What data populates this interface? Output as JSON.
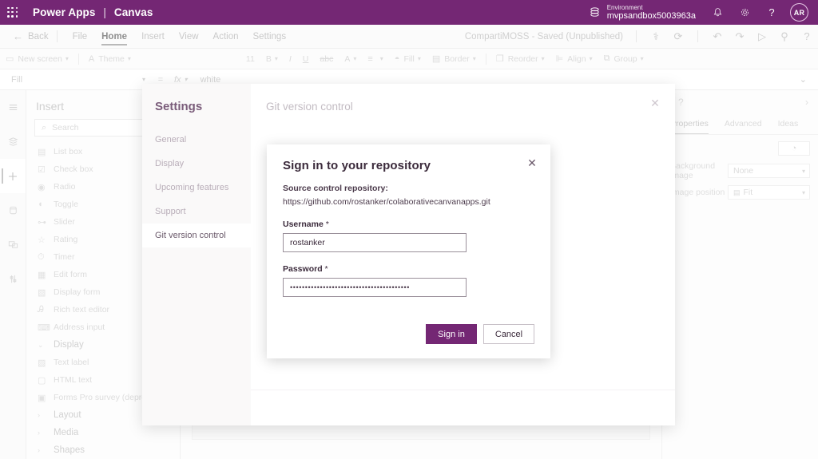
{
  "brandbar": {
    "waffle_icon": "app-launcher-icon",
    "app_name": "Power Apps",
    "separator": "|",
    "app_mode": "Canvas",
    "environment_icon": "environment-icon",
    "environment_label": "Environment",
    "environment_name": "mvpsandbox5003963a",
    "notifications_icon": "bell-icon",
    "settings_icon": "gear-icon",
    "help_icon": "question-icon",
    "avatar_initials": "AR",
    "accent_color": "#742774"
  },
  "menubar": {
    "back_label": "Back",
    "items": [
      {
        "label": "File",
        "active": false
      },
      {
        "label": "Home",
        "active": true
      },
      {
        "label": "Insert",
        "active": false
      },
      {
        "label": "View",
        "active": false
      },
      {
        "label": "Action",
        "active": false
      },
      {
        "label": "Settings",
        "active": false
      }
    ],
    "saved_status": "CompartiMOSS - Saved (Unpublished)",
    "right_icons": [
      "checker-icon",
      "refresh-icon",
      "undo-icon",
      "redo-icon",
      "play-icon",
      "share-icon",
      "help-icon"
    ]
  },
  "ribbon": {
    "new_screen": "New screen",
    "theme": "Theme",
    "font_size": "11",
    "bold": "B",
    "italic": "I",
    "underline": "U",
    "strikethrough": "abc",
    "font_color": "A",
    "align": "align-icon",
    "fill": "Fill",
    "border": "Border",
    "reorder": "Reorder",
    "align_label": "Align",
    "group": "Group"
  },
  "formulabar": {
    "property": "Fill",
    "equals": "=",
    "fx": "fx",
    "value": "white",
    "expand_icon": "chevron-down-icon"
  },
  "rail": {
    "items": [
      {
        "name": "hamburger-icon",
        "active": false
      },
      {
        "name": "tree-view-icon",
        "active": false
      },
      {
        "name": "insert-icon",
        "active": true
      },
      {
        "name": "data-icon",
        "active": false
      },
      {
        "name": "media-icon",
        "active": false
      },
      {
        "name": "variables-icon",
        "active": false
      }
    ]
  },
  "insert_panel": {
    "title": "Insert",
    "search_placeholder": "Search",
    "search_icon": "search-icon",
    "items": [
      {
        "label": "List box",
        "icon": "listbox-icon",
        "type": "item"
      },
      {
        "label": "Check box",
        "icon": "checkbox-icon",
        "type": "item"
      },
      {
        "label": "Radio",
        "icon": "radio-icon",
        "type": "item"
      },
      {
        "label": "Toggle",
        "icon": "toggle-icon",
        "type": "item"
      },
      {
        "label": "Slider",
        "icon": "slider-icon",
        "type": "item"
      },
      {
        "label": "Rating",
        "icon": "star-icon",
        "type": "item"
      },
      {
        "label": "Timer",
        "icon": "timer-icon",
        "type": "item"
      },
      {
        "label": "Edit form",
        "icon": "edit-form-icon",
        "type": "item"
      },
      {
        "label": "Display form",
        "icon": "display-form-icon",
        "type": "item"
      },
      {
        "label": "Rich text editor",
        "icon": "rich-text-icon",
        "type": "item"
      },
      {
        "label": "Address input",
        "icon": "address-input-icon",
        "type": "item"
      },
      {
        "label": "Display",
        "icon": "chevron-down-icon",
        "type": "group"
      },
      {
        "label": "Text label",
        "icon": "text-label-icon",
        "type": "item"
      },
      {
        "label": "HTML text",
        "icon": "html-text-icon",
        "type": "item"
      },
      {
        "label": "Forms Pro survey (deprec...",
        "icon": "forms-pro-icon",
        "type": "item"
      },
      {
        "label": "Layout",
        "icon": "chevron-right-icon",
        "type": "group"
      },
      {
        "label": "Media",
        "icon": "chevron-right-icon",
        "type": "group"
      },
      {
        "label": "Shapes",
        "icon": "chevron-right-icon",
        "type": "group"
      }
    ]
  },
  "right_panel": {
    "help_icon": "question-circle-icon",
    "collapse_icon": "chevron-right-icon",
    "tabs": [
      {
        "label": "Properties",
        "active": true
      },
      {
        "label": "Advanced",
        "active": false
      },
      {
        "label": "Ideas",
        "active": false
      }
    ],
    "paint_icon": "paint-bucket-icon",
    "rows": [
      {
        "label": "Background image",
        "value": "None",
        "has_image_icon": false
      },
      {
        "label": "Image position",
        "value": "Fit",
        "has_image_icon": true
      }
    ]
  },
  "settings_modal": {
    "heading": "Settings",
    "nav_items": [
      {
        "label": "General",
        "active": false
      },
      {
        "label": "Display",
        "active": false
      },
      {
        "label": "Upcoming features",
        "active": false
      },
      {
        "label": "Support",
        "active": false
      },
      {
        "label": "Git version control",
        "active": true
      }
    ],
    "body_title": "Git version control",
    "close_icon": "close-icon"
  },
  "signin_dialog": {
    "title": "Sign in to your repository",
    "close_icon": "close-icon",
    "repo_label": "Source control repository:",
    "repo_url": "https://github.com/rostanker/colaborativecanvanapps.git",
    "username_label": "Username",
    "required_marker": "*",
    "username_value": "rostanker",
    "password_label": "Password",
    "password_value": "••••••••••••••••••••••••••••••••••••••••",
    "primary_button": "Sign in",
    "secondary_button": "Cancel",
    "primary_color": "#742774"
  }
}
